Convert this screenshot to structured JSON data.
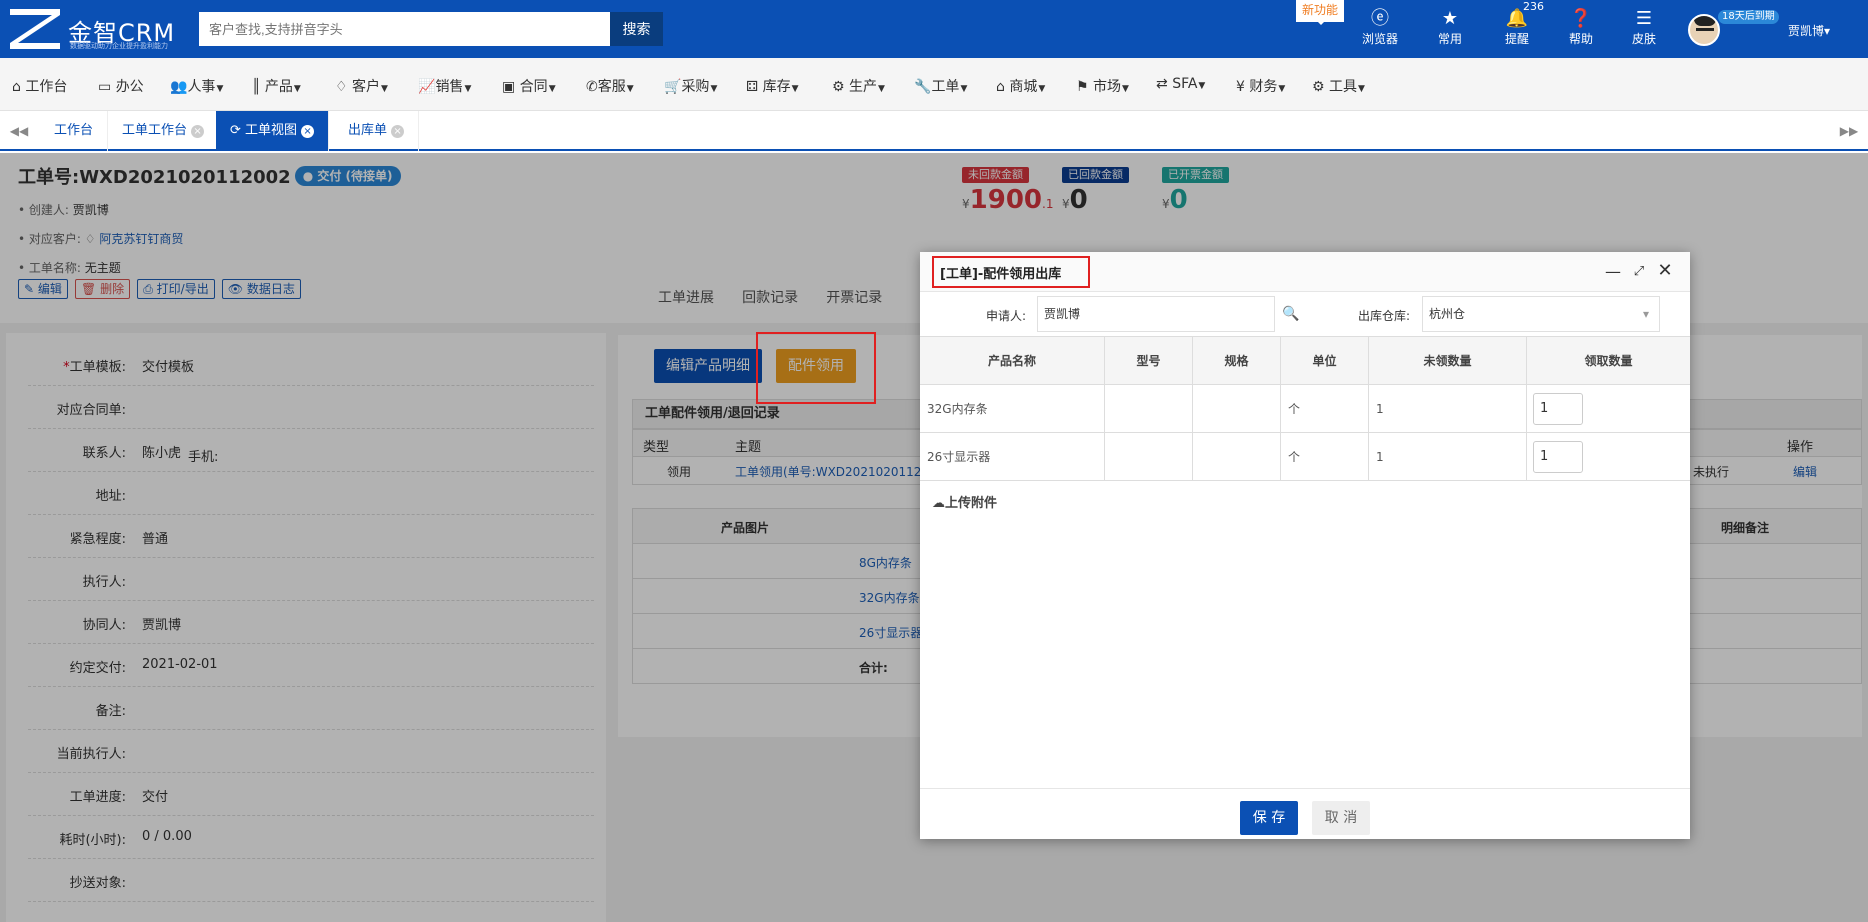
{
  "app": {
    "logo_text": "金智CRM",
    "logo_sub": "数据驱动助力企业提升盈利能力",
    "search_placeholder": "客户查找,支持拼音字头",
    "search_button": "搜索",
    "new_feature": "新功能",
    "top_nav": [
      {
        "label": "浏览器",
        "icon": "ie-icon"
      },
      {
        "label": "常用",
        "icon": "star-icon"
      },
      {
        "label": "提醒",
        "icon": "bell-icon",
        "badge": "236"
      },
      {
        "label": "帮助",
        "icon": "help-icon"
      },
      {
        "label": "皮肤",
        "icon": "skin-icon"
      }
    ],
    "trial_badge": "18天后到期",
    "user_name": "贾凯博"
  },
  "menu": [
    {
      "label": "工作台",
      "icon": "home-icon"
    },
    {
      "label": "办公",
      "icon": "laptop-icon"
    },
    {
      "label": "人事",
      "icon": "users-icon"
    },
    {
      "label": "产品",
      "icon": "barcode-icon"
    },
    {
      "label": "客户",
      "icon": "diamond-icon"
    },
    {
      "label": "销售",
      "icon": "chart-icon"
    },
    {
      "label": "合同",
      "icon": "contract-icon"
    },
    {
      "label": "客服",
      "icon": "phone-icon"
    },
    {
      "label": "采购",
      "icon": "cart-icon"
    },
    {
      "label": "库存",
      "icon": "cubes-icon"
    },
    {
      "label": "生产",
      "icon": "cogs-icon"
    },
    {
      "label": "工单",
      "icon": "wrench-icon"
    },
    {
      "label": "商城",
      "icon": "shop-icon"
    },
    {
      "label": "市场",
      "icon": "flag-icon"
    },
    {
      "label": "SFA",
      "icon": "refresh-icon"
    },
    {
      "label": "财务",
      "icon": "yen-icon"
    },
    {
      "label": "工具",
      "icon": "gear-icon"
    }
  ],
  "tabs": [
    {
      "label": "工作台",
      "closable": false
    },
    {
      "label": "工单工作台",
      "closable": true
    },
    {
      "label": "工单视图",
      "closable": true,
      "active": true
    },
    {
      "label": "出库单",
      "closable": true
    }
  ],
  "workorder": {
    "number": "工单号:WXD2021020112002",
    "status": "交付 (待接单)",
    "creator_label": "创建人:",
    "creator": "贾凯博",
    "customer_label": "对应客户:",
    "customer": "阿克苏钉钉商贸",
    "name_label": "工单名称:",
    "name": "无主题",
    "actions": [
      "编辑",
      "删除",
      "打印/导出",
      "数据日志"
    ]
  },
  "amounts": [
    {
      "label": "未回款金额",
      "value": "1900",
      "decimal": ".1",
      "color": "#d9363e"
    },
    {
      "label": "已回款金额",
      "value": "0",
      "decimal": "",
      "color": "#0b3d91"
    },
    {
      "label": "已开票金额",
      "value": "0",
      "decimal": "",
      "color": "#20a8a0"
    }
  ],
  "currency": "¥",
  "subtabs": [
    "工单进展",
    "回款记录",
    "开票记录"
  ],
  "fields": [
    {
      "label": "工单模板:",
      "value": "交付模板",
      "required": true
    },
    {
      "label": "对应合同单:",
      "value": ""
    },
    {
      "label": "联系人:",
      "value": "陈小虎",
      "extra": "手机:"
    },
    {
      "label": "地址:",
      "value": ""
    },
    {
      "label": "紧急程度:",
      "value": "普通"
    },
    {
      "label": "执行人:",
      "value": ""
    },
    {
      "label": "协同人:",
      "value": "贾凯博"
    },
    {
      "label": "约定交付:",
      "value": "2021-02-01"
    },
    {
      "label": "备注:",
      "value": ""
    },
    {
      "label": "当前执行人:",
      "value": ""
    },
    {
      "label": "工单进度:",
      "value": "交付"
    },
    {
      "label": "耗时(小时):",
      "value": "0 / 0.00"
    },
    {
      "label": "抄送对象:",
      "value": ""
    }
  ],
  "right": {
    "edit_button": "编辑产品明细",
    "parts_button": "配件领用",
    "record_title": "工单配件领用/退回记录",
    "record_headers": [
      "类型",
      "主题",
      "操作"
    ],
    "record_row": {
      "type": "领用",
      "subject": "工单领用(单号:WXD20210201120",
      "status": "未执行",
      "action": "编辑"
    },
    "prod_headers": [
      "产品图片",
      "明细备注"
    ],
    "prod_rows": [
      "8G内存条",
      "32G内存条",
      "26寸显示器"
    ],
    "total_label": "合计:"
  },
  "modal": {
    "title": "[工单]-配件领用出库",
    "applicant_label": "申请人:",
    "applicant": "贾凯博",
    "warehouse_label": "出库仓库:",
    "warehouse": "杭州仓",
    "headers": [
      "产品名称",
      "型号",
      "规格",
      "单位",
      "未领数量",
      "领取数量"
    ],
    "rows": [
      {
        "name": "32G内存条",
        "model": "",
        "spec": "",
        "unit": "个",
        "unclaimed": "1",
        "qty": "1"
      },
      {
        "name": "26寸显示器",
        "model": "",
        "spec": "",
        "unit": "个",
        "unclaimed": "1",
        "qty": "1"
      }
    ],
    "upload": "上传附件",
    "save": "保 存",
    "cancel": "取 消"
  }
}
